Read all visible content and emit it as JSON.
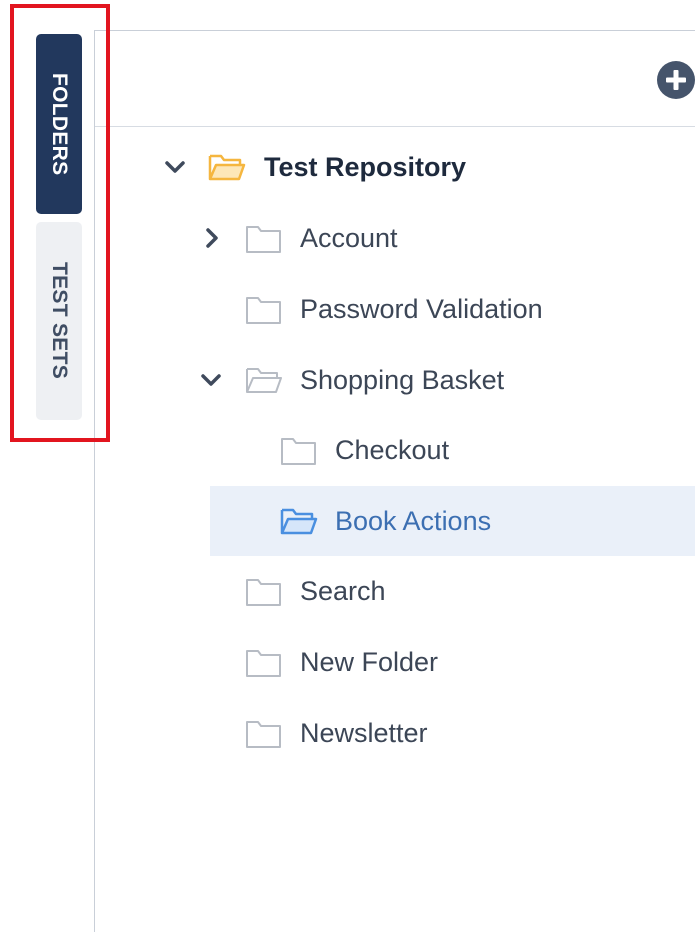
{
  "sidebar": {
    "tabs": [
      {
        "label": "FOLDERS",
        "active": true
      },
      {
        "label": "TEST SETS",
        "active": false
      }
    ]
  },
  "toolbar": {
    "add_icon": "plus-circle-icon"
  },
  "colors": {
    "tab_active_bg": "#22385d",
    "tab_inactive_bg": "#eef0f3",
    "highlight_border": "#e2151f",
    "root_folder": "#f5b63f",
    "selected_folder": "#4a8fe0",
    "selected_row_bg": "#eaf0f9",
    "folder_gray": "#b7bcc4"
  },
  "tree": {
    "nodes": [
      {
        "label": "Test Repository",
        "expanded": true,
        "icon": "folder-open-icon"
      },
      {
        "label": "Account",
        "expanded": false,
        "icon": "folder-icon"
      },
      {
        "label": "Password Validation",
        "icon": "folder-icon"
      },
      {
        "label": "Shopping Basket",
        "expanded": true,
        "icon": "folder-open-icon"
      },
      {
        "label": "Checkout",
        "icon": "folder-icon"
      },
      {
        "label": "Book Actions",
        "selected": true,
        "icon": "folder-open-icon"
      },
      {
        "label": "Search",
        "icon": "folder-icon"
      },
      {
        "label": "New Folder",
        "icon": "folder-icon"
      },
      {
        "label": "Newsletter",
        "icon": "folder-icon"
      }
    ]
  }
}
